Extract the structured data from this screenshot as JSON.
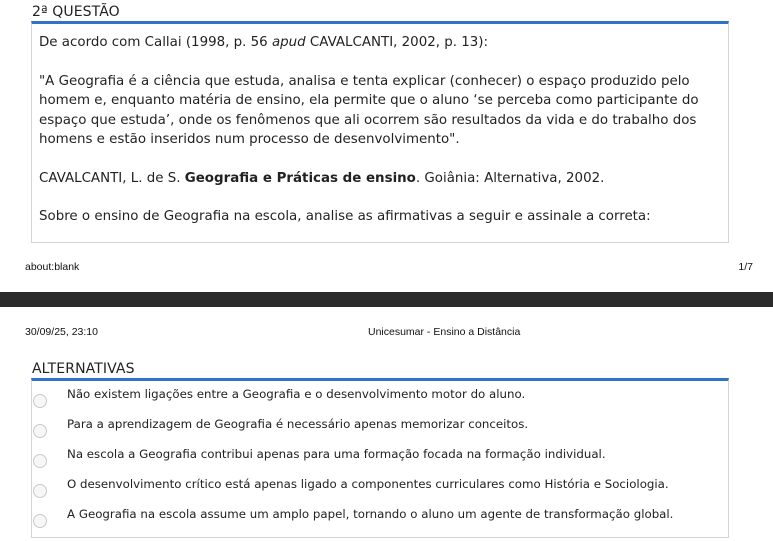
{
  "question": {
    "section_title": "2ª QUESTÃO",
    "intro": "De acordo com Callai (1998, p. 56 ",
    "intro_italic": "apud",
    "intro_end": " CAVALCANTI, 2002, p. 13):",
    "quote": "\"A Geografia é a ciência que estuda, analisa e tenta explicar (conhecer) o espaço produzido pelo homem e, enquanto matéria de ensino, ela permite que o aluno ‘se perceba como participante do espaço que estuda’, onde os fenômenos que ali ocorrem são resultados da vida e do trabalho dos homens e estão inseridos num processo de desenvolvimento\".",
    "ref_author": "CAVALCANTI, L. de S. ",
    "ref_title": "Geografia e Práticas de ensino",
    "ref_rest": ". Goiânia: Alternativa, 2002.",
    "prompt": "Sobre o ensino de Geografia na escola, analise as afirmativas a seguir e assinale a correta:"
  },
  "page_footer": {
    "url": "about:blank",
    "page": "1/7"
  },
  "page_header": {
    "datetime": "30/09/25, 23:10",
    "site": "Unicesumar - Ensino a Distância"
  },
  "alternatives": {
    "section_title": "ALTERNATIVAS",
    "options": [
      "Não existem ligações entre a Geografia e o desenvolvimento motor do aluno.",
      "Para a aprendizagem de Geografia é necessário apenas memorizar conceitos.",
      "Na escola a Geografia contribui apenas para uma formação focada na formação individual.",
      "O desenvolvimento crítico está apenas ligado a componentes curriculares como História e Sociologia.",
      "A Geografia na escola assume um amplo papel, tornando o aluno um agente de transformação global."
    ]
  },
  "colors": {
    "accent": "#2f73c9",
    "border": "#d4d4d4",
    "page_separator": "#2b2b2b"
  }
}
